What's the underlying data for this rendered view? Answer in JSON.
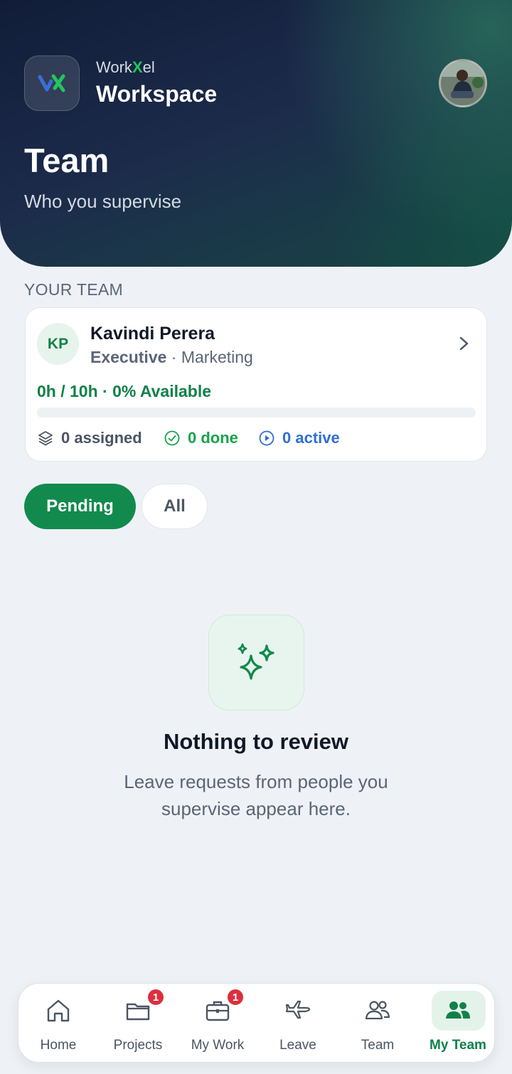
{
  "header": {
    "brand_prefix": "Work",
    "brand_x": "X",
    "brand_suffix": "el",
    "workspace": "Workspace",
    "title": "Team",
    "subtitle": "Who you supervise"
  },
  "team_section": {
    "label": "YOUR TEAM",
    "member": {
      "initials": "KP",
      "name": "Kavindi Perera",
      "role": "Executive",
      "separator": " · ",
      "department": "Marketing",
      "availability": "0h / 10h · 0% Available",
      "availability_fraction": 0,
      "assigned": "0 assigned",
      "done": "0 done",
      "active": "0 active"
    }
  },
  "filters": {
    "pending": "Pending",
    "all": "All",
    "selected": "Pending"
  },
  "empty_state": {
    "title": "Nothing to review",
    "description": "Leave requests from people you supervise appear here."
  },
  "nav": {
    "items": [
      {
        "label": "Home",
        "icon": "home-icon",
        "badge": ""
      },
      {
        "label": "Projects",
        "icon": "folder-icon",
        "badge": "1"
      },
      {
        "label": "My Work",
        "icon": "briefcase-icon",
        "badge": "1"
      },
      {
        "label": "Leave",
        "icon": "plane-icon",
        "badge": ""
      },
      {
        "label": "Team",
        "icon": "users-icon",
        "badge": ""
      },
      {
        "label": "My Team",
        "icon": "users-filled-icon",
        "badge": ""
      }
    ],
    "active": "My Team"
  },
  "colors": {
    "accent": "#128a4e",
    "badge": "#dc2f3e",
    "active_blue": "#2f6fd0"
  }
}
